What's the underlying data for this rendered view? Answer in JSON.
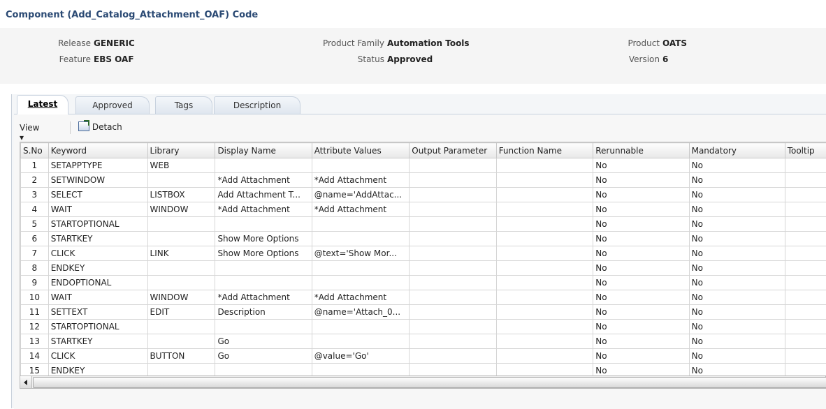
{
  "page_title": "Component (Add_Catalog_Attachment_OAF) Code",
  "info": {
    "release_label": "Release",
    "release_value": "GENERIC",
    "feature_label": "Feature",
    "feature_value": "EBS OAF",
    "product_family_label": "Product Family",
    "product_family_value": "Automation Tools",
    "status_label": "Status",
    "status_value": "Approved",
    "product_label": "Product",
    "product_value": "OATS",
    "version_label": "Version",
    "version_value": "6"
  },
  "tabs": [
    {
      "label": "Latest",
      "active": true
    },
    {
      "label": "Approved",
      "active": false
    },
    {
      "label": "Tags",
      "active": false
    },
    {
      "label": "Description",
      "active": false
    }
  ],
  "toolbar": {
    "view_label": "View",
    "detach_label": "Detach"
  },
  "columns": [
    "S.No",
    "Keyword",
    "Library",
    "Display Name",
    "Attribute Values",
    "Output Parameter",
    "Function Name",
    "Rerunnable",
    "Mandatory",
    "Tooltip"
  ],
  "rows": [
    [
      "1",
      "SETAPPTYPE",
      "WEB",
      "",
      "",
      "",
      "",
      "No",
      "No",
      ""
    ],
    [
      "2",
      "SETWINDOW",
      "",
      "*Add Attachment",
      "*Add Attachment",
      "",
      "",
      "No",
      "No",
      ""
    ],
    [
      "3",
      "SELECT",
      "LISTBOX",
      "Add Attachment T...",
      "@name='AddAttac...",
      "",
      "",
      "No",
      "No",
      ""
    ],
    [
      "4",
      "WAIT",
      "WINDOW",
      "*Add Attachment",
      "*Add Attachment",
      "",
      "",
      "No",
      "No",
      ""
    ],
    [
      "5",
      "STARTOPTIONAL",
      "",
      "",
      "",
      "",
      "",
      "No",
      "No",
      ""
    ],
    [
      "6",
      "STARTKEY",
      "",
      "Show More Options",
      "",
      "",
      "",
      "No",
      "No",
      ""
    ],
    [
      "7",
      "CLICK",
      "LINK",
      "Show More Options",
      "@text='Show Mor...",
      "",
      "",
      "No",
      "No",
      ""
    ],
    [
      "8",
      "ENDKEY",
      "",
      "",
      "",
      "",
      "",
      "No",
      "No",
      ""
    ],
    [
      "9",
      "ENDOPTIONAL",
      "",
      "",
      "",
      "",
      "",
      "No",
      "No",
      ""
    ],
    [
      "10",
      "WAIT",
      "WINDOW",
      "*Add Attachment",
      "*Add Attachment",
      "",
      "",
      "No",
      "No",
      ""
    ],
    [
      "11",
      "SETTEXT",
      "EDIT",
      "Description",
      "@name='Attach_0...",
      "",
      "",
      "No",
      "No",
      ""
    ],
    [
      "12",
      "STARTOPTIONAL",
      "",
      "",
      "",
      "",
      "",
      "No",
      "No",
      ""
    ],
    [
      "13",
      "STARTKEY",
      "",
      "Go",
      "",
      "",
      "",
      "No",
      "No",
      ""
    ],
    [
      "14",
      "CLICK",
      "BUTTON",
      "Go",
      "@value='Go'",
      "",
      "",
      "No",
      "No",
      ""
    ],
    [
      "15",
      "ENDKEY",
      "",
      "",
      "",
      "",
      "",
      "No",
      "No",
      ""
    ]
  ]
}
